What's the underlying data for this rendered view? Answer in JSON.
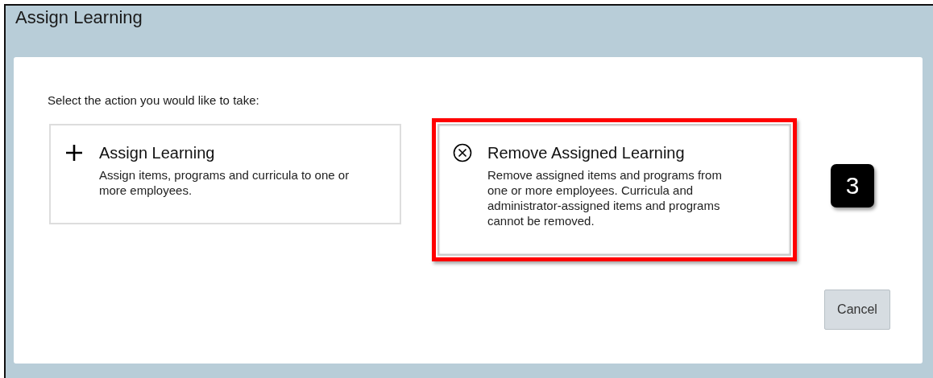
{
  "window": {
    "title": "Assign Learning"
  },
  "prompt": "Select the action you would like to take:",
  "options": [
    {
      "kind": "add",
      "title": "Assign Learning",
      "description": "Assign items, programs and curricula to one or more employees.",
      "highlighted": false
    },
    {
      "kind": "remove",
      "title": "Remove Assigned Learning",
      "description": "Remove assigned items and programs from one or more employees. Curricula and administrator-assigned items and programs cannot be removed.",
      "highlighted": true
    }
  ],
  "step_badge": "3",
  "buttons": [
    "Cancel"
  ]
}
